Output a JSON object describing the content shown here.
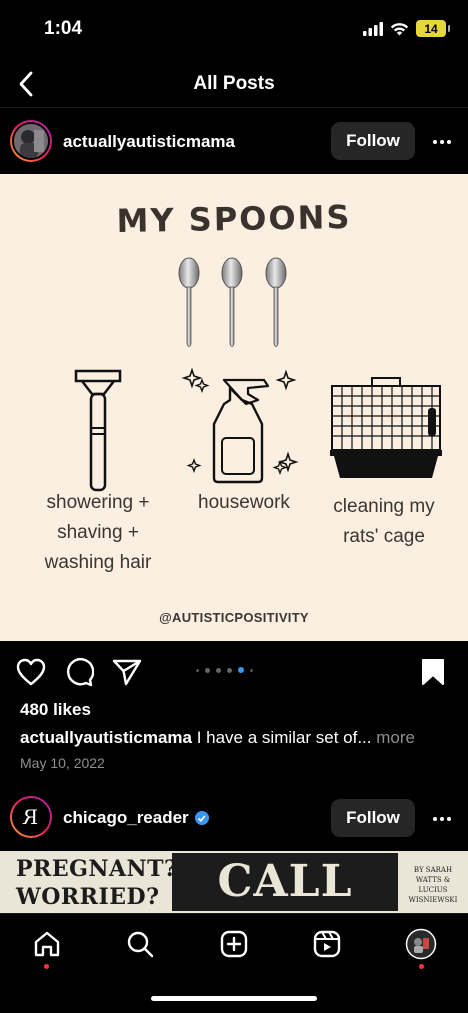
{
  "status_bar": {
    "time": "1:04",
    "battery": "14"
  },
  "nav": {
    "title": "All Posts"
  },
  "post": {
    "username": "actuallyautisticmama",
    "follow_label": "Follow",
    "image": {
      "title": "MY SPOONS",
      "captions": [
        "showering + shaving + washing hair",
        "housework",
        "cleaning my rats' cage"
      ],
      "credit": "@AUTISTICPOSITIVITY"
    },
    "carousel": {
      "count": 6,
      "active_index": 4
    },
    "likes": "480 likes",
    "caption_user": "actuallyautisticmama",
    "caption_text": "I have a similar set of...",
    "caption_more": "more",
    "date": "May 10, 2022"
  },
  "next_post": {
    "username": "chicago_reader",
    "verified": true,
    "follow_label": "Follow",
    "avatar_letter": "R",
    "preview": {
      "left_line1": "PREGNANT?",
      "left_line2": "WORRIED?",
      "title": "CALL JANE",
      "byline": "BY SARAH WATTS & LUCIUS WISNIEWSKI"
    }
  },
  "tabs": [
    "home-icon",
    "search-icon",
    "create-icon",
    "reels-icon",
    "profile-icon"
  ],
  "colors": {
    "accent": "#3897f0",
    "notification": "#ff3040",
    "image_bg": "#fbefe1",
    "follow_bg": "#262626"
  }
}
